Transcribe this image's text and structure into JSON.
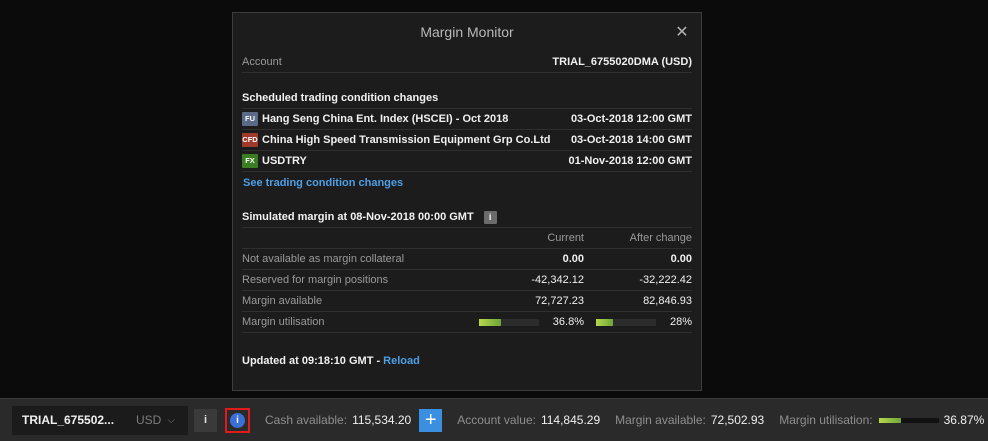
{
  "dialog": {
    "title": "Margin Monitor",
    "account_label": "Account",
    "account_value": "TRIAL_6755020DMA (USD)",
    "scheduled_title": "Scheduled trading condition changes",
    "scheduled": [
      {
        "badge": "FU",
        "name": "Hang Seng China Ent. Index (HSCEI) - Oct 2018",
        "date": "03-Oct-2018 12:00 GMT"
      },
      {
        "badge": "CFD",
        "name": "China High Speed Transmission Equipment Grp Co.Ltd",
        "date": "03-Oct-2018 14:00 GMT"
      },
      {
        "badge": "FX",
        "name": "USDTRY",
        "date": "01-Nov-2018 12:00 GMT"
      }
    ],
    "see_changes_link": "See trading condition changes",
    "simulated_title": "Simulated margin at 08-Nov-2018 00:00 GMT",
    "info_glyph": "i",
    "col_current": "Current",
    "col_after": "After change",
    "rows": [
      {
        "label": "Not available as margin collateral",
        "current": "0.00",
        "after": "0.00"
      },
      {
        "label": "Reserved for margin positions",
        "current": "-42,342.12",
        "after": "-32,222.42"
      },
      {
        "label": "Margin available",
        "current": "72,727.23",
        "after": "82,846.93"
      }
    ],
    "utilisation": {
      "label": "Margin utilisation",
      "current": "36.8%",
      "current_fraction": 0.368,
      "after": "28%",
      "after_fraction": 0.28
    },
    "updated_prefix": "Updated at 09:18:10 GMT - ",
    "reload_link": "Reload",
    "close_glyph": "✕"
  },
  "bottombar": {
    "account_name": "TRIAL_675502...",
    "currency": "USD",
    "chevron": "⌵",
    "info_button": "i",
    "margin_info_glyph": "i",
    "cash_label": "Cash available:",
    "cash_value": "115,534.20",
    "plus_glyph": "+",
    "account_value_label": "Account value:",
    "account_value": "114,845.29",
    "margin_available_label": "Margin available:",
    "margin_available_value": "72,502.93",
    "margin_util_label": "Margin utilisation:",
    "margin_util_value": "36.87%",
    "margin_util_fraction": 0.3687
  },
  "colors": {
    "accent": "#3a8fe0",
    "link": "#4d9fe6",
    "highlight": "#e11b1b"
  }
}
